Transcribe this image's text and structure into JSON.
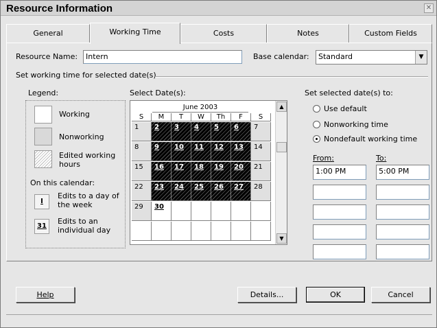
{
  "window": {
    "title": "Resource Information"
  },
  "tabs": [
    {
      "label": "General"
    },
    {
      "label": "Working Time"
    },
    {
      "label": "Costs"
    },
    {
      "label": "Notes"
    },
    {
      "label": "Custom Fields"
    }
  ],
  "resource": {
    "name_label": "Resource Name:",
    "name_value": "Intern",
    "base_calendar_label": "Base calendar:",
    "base_calendar_value": "Standard"
  },
  "section_title": "Set working time for selected date(s)",
  "legend": {
    "title": "Legend:",
    "working": "Working",
    "nonworking": "Nonworking",
    "edited": "Edited working hours",
    "on_this_calendar": "On this calendar:",
    "edits_day_week": "Edits to a day of the week",
    "edits_individual": "Edits to an individual day",
    "icon_week": "I",
    "icon_day": "31"
  },
  "calendar": {
    "select_label": "Select Date(s):",
    "month": "June 2003",
    "dow": [
      "S",
      "M",
      "T",
      "W",
      "Th",
      "F",
      "S"
    ],
    "weeks": [
      [
        "1",
        "2",
        "3",
        "4",
        "5",
        "6",
        "7"
      ],
      [
        "8",
        "9",
        "10",
        "11",
        "12",
        "13",
        "14"
      ],
      [
        "15",
        "16",
        "17",
        "18",
        "19",
        "20",
        "21"
      ],
      [
        "22",
        "23",
        "24",
        "25",
        "26",
        "27",
        "28"
      ],
      [
        "29",
        "30",
        "",
        "",
        "",
        "",
        ""
      ],
      [
        "",
        "",
        "",
        "",
        "",
        "",
        ""
      ]
    ]
  },
  "set_to": {
    "title": "Set selected date(s) to:",
    "use_default": "Use default",
    "nonworking": "Nonworking time",
    "nondefault": "Nondefault working time",
    "from_label": "From:",
    "to_label": "To:",
    "rows": [
      {
        "from": "1:00 PM",
        "to": "5:00 PM"
      },
      {
        "from": "",
        "to": ""
      },
      {
        "from": "",
        "to": ""
      },
      {
        "from": "",
        "to": ""
      },
      {
        "from": "",
        "to": ""
      }
    ]
  },
  "buttons": {
    "help": "Help",
    "details": "Details...",
    "ok": "OK",
    "cancel": "Cancel"
  }
}
